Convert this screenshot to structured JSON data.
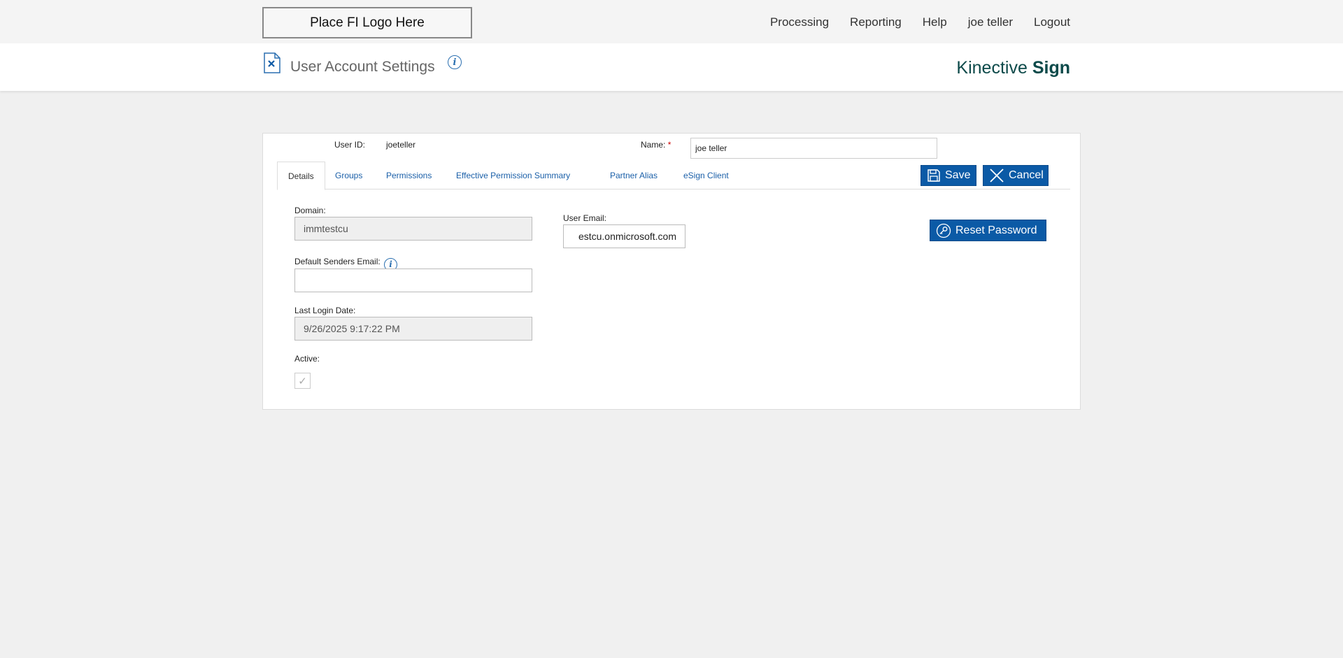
{
  "header": {
    "logo_text": "Place FI Logo Here",
    "nav": [
      "Processing",
      "Reporting",
      "Help",
      "joe teller",
      "Logout"
    ]
  },
  "title_bar": {
    "title": "User Account Settings",
    "info_icon": "info-icon",
    "brand_light": "Kinective",
    "brand_bold": "Sign"
  },
  "user": {
    "user_id_label": "User ID:",
    "user_id": "joeteller",
    "name_label": "Name:",
    "required_mark": "*",
    "name_value": "joe teller"
  },
  "tabs": [
    "Details",
    "Groups",
    "Permissions",
    "Effective Permission Summary",
    "Partner Alias",
    "eSign Client"
  ],
  "active_tab": "Details",
  "actions": {
    "save": "Save",
    "cancel": "Cancel",
    "reset_password": "Reset Password"
  },
  "details": {
    "domain_label": "Domain:",
    "domain_value": "immtestcu",
    "default_senders_email_label": "Default Senders Email:",
    "default_senders_email_value": "",
    "last_login_label": "Last Login Date:",
    "last_login_value": "9/26/2025 9:17:22 PM",
    "active_label": "Active:",
    "active_checked": true,
    "user_email_label": "User Email:",
    "user_email_value": "estcu.onmicrosoft.com"
  },
  "colors": {
    "primary_button": "#0b5aa6",
    "link": "#1a5fa8",
    "brand": "#0d4a4a"
  }
}
